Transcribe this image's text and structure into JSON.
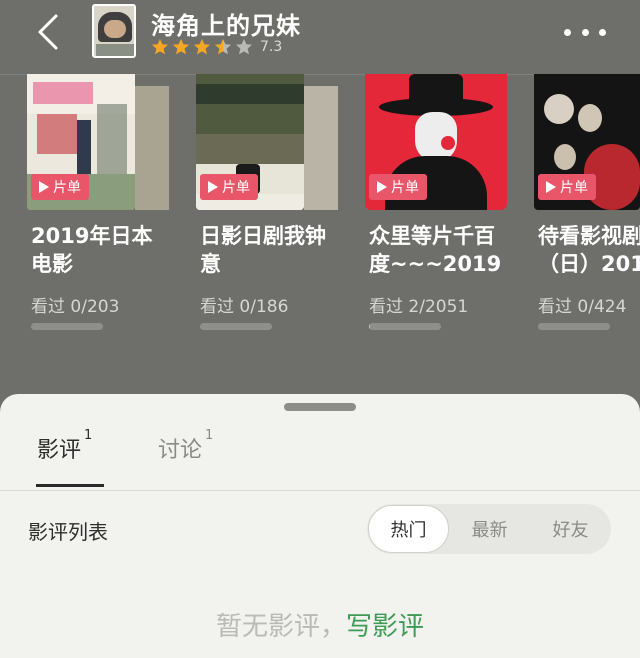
{
  "header": {
    "title": "海角上的兄妹",
    "rating_value": "7.3",
    "rating_stars": 3.5
  },
  "doulists": [
    {
      "title": "2019年日本\n电影",
      "badge": "片单",
      "count": "看过 0/203",
      "progress": 0.0
    },
    {
      "title": "日影日剧我钟\n意",
      "badge": "片单",
      "count": "看过 0/186",
      "progress": 0.0
    },
    {
      "title": "众里等片千百\n度~~~2019",
      "badge": "片单",
      "count": "看过 2/2051",
      "progress": 0.001
    },
    {
      "title": "待看影视剧\n（日）201",
      "badge": "片单",
      "count": "看过 0/424",
      "progress": 0.0
    }
  ],
  "sheet": {
    "tabs": [
      {
        "label": "影评",
        "count": "1"
      },
      {
        "label": "讨论",
        "count": "1"
      }
    ],
    "list_label": "影评列表",
    "filters": [
      "热门",
      "最新",
      "好友"
    ],
    "empty_text": "暂无影评，",
    "write_link": "写影评"
  },
  "colors": {
    "background": "#6e6f6a",
    "sheet": "#f2f3ee",
    "badge": "#e9566a",
    "link_green": "#3f9a56",
    "star": "#f5a623"
  }
}
